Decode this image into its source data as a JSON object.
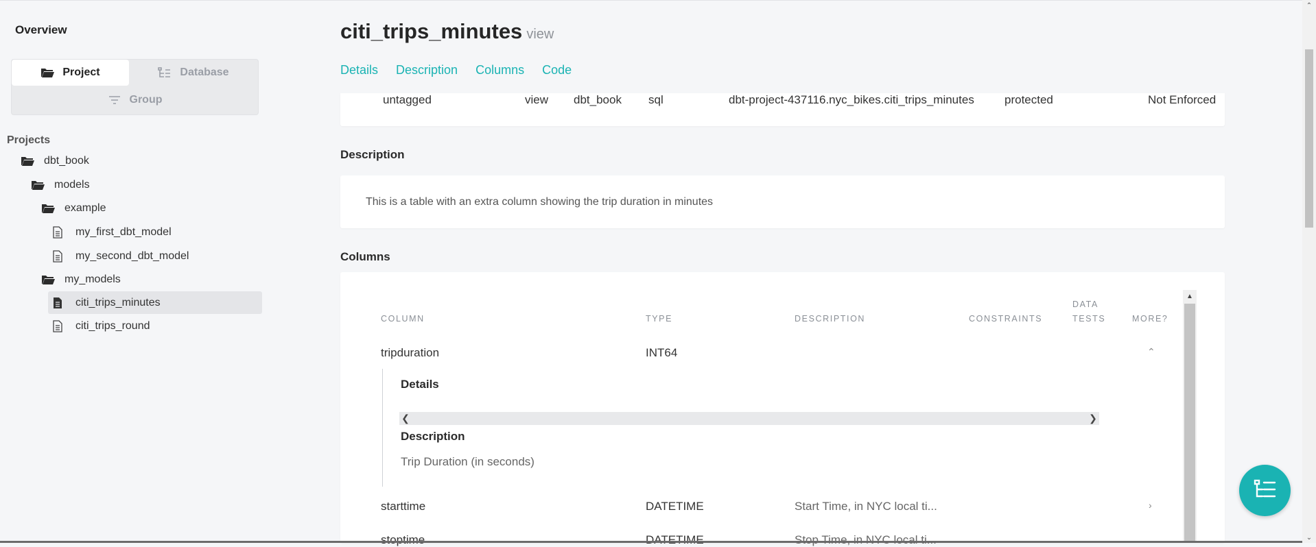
{
  "sidebar": {
    "overview": "Overview",
    "toggle": {
      "project": "Project",
      "database": "Database",
      "group": "Group"
    },
    "projects_label": "Projects",
    "tree": [
      {
        "label": "dbt_book",
        "kind": "folder"
      },
      {
        "label": "models",
        "kind": "folder"
      },
      {
        "label": "example",
        "kind": "folder"
      },
      {
        "label": "my_first_dbt_model",
        "kind": "file"
      },
      {
        "label": "my_second_dbt_model",
        "kind": "file"
      },
      {
        "label": "my_models",
        "kind": "folder"
      },
      {
        "label": "citi_trips_minutes",
        "kind": "file",
        "selected": true
      },
      {
        "label": "citi_trips_round",
        "kind": "file"
      }
    ]
  },
  "header": {
    "title": "citi_trips_minutes",
    "subtitle": "view",
    "tabs": [
      "Details",
      "Description",
      "Columns",
      "Code"
    ]
  },
  "meta": {
    "tags": "untagged",
    "materialization": "view",
    "package": "dbt_book",
    "language": "sql",
    "relation": "dbt-project-437116.nyc_bikes.citi_trips_minutes",
    "access": "protected",
    "contract": "Not Enforced"
  },
  "description": {
    "title": "Description",
    "text": "This is a table with an extra column showing the trip duration in minutes"
  },
  "columns": {
    "title": "Columns",
    "headers": {
      "column": "COLUMN",
      "type": "TYPE",
      "description": "DESCRIPTION",
      "constraints": "CONSTRAINTS",
      "data_tests_1": "DATA",
      "data_tests_2": "TESTS",
      "more": "MORE?"
    },
    "rows": [
      {
        "name": "tripduration",
        "type": "INT64",
        "description": ""
      },
      {
        "name": "starttime",
        "type": "DATETIME",
        "description": "Start Time, in NYC local ti..."
      },
      {
        "name": "stoptime",
        "type": "DATETIME",
        "description": "Stop Time, in NYC local ti..."
      }
    ],
    "expanded": {
      "details_title": "Details",
      "description_title": "Description",
      "description_text": "Trip Duration (in seconds)"
    }
  },
  "colors": {
    "accent": "#1ab3b3",
    "background": "#f5f6f8"
  }
}
